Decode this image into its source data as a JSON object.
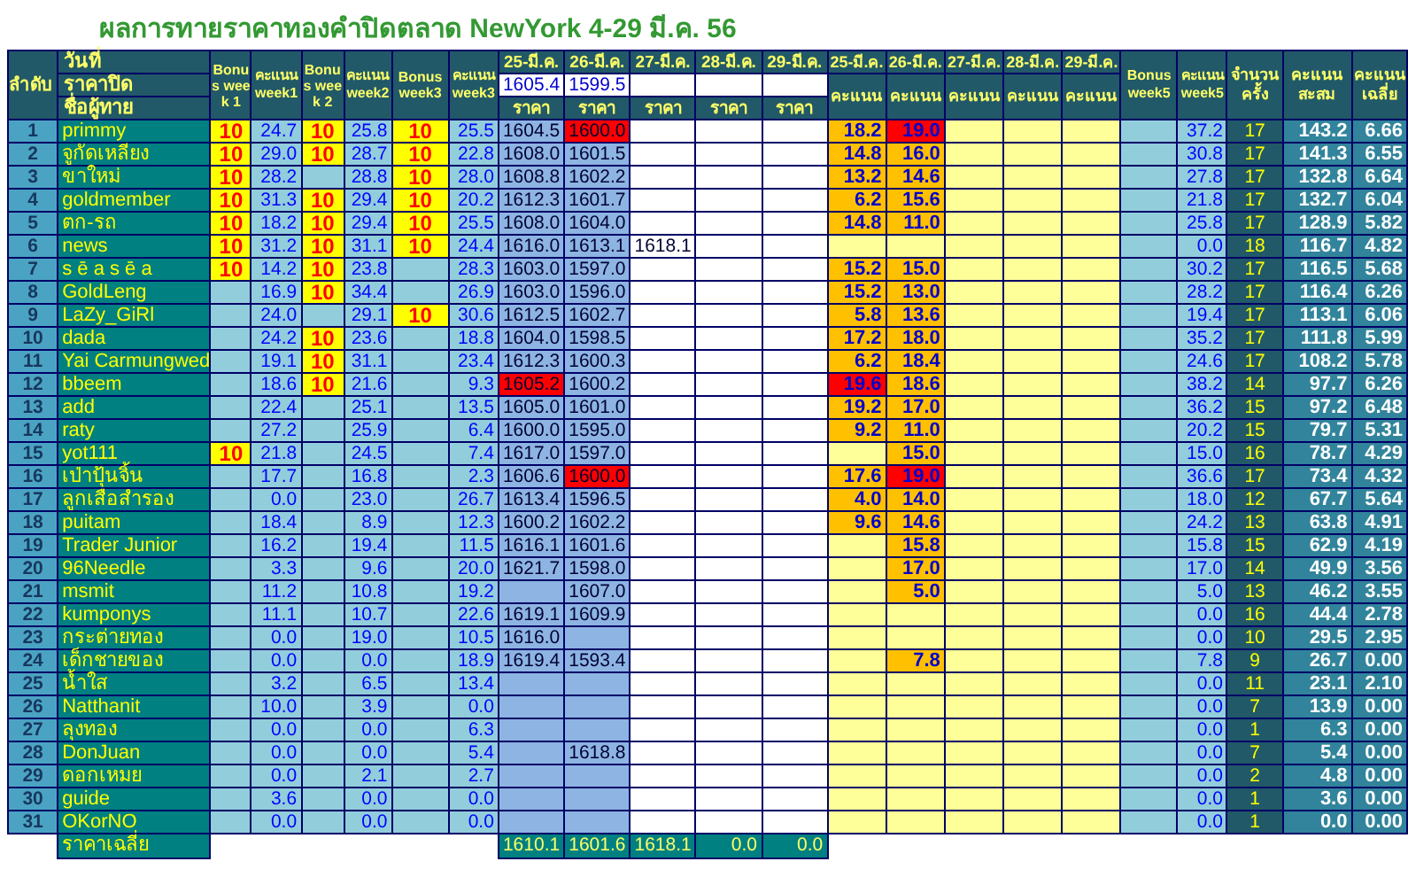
{
  "title": "ผลการทายราคาทองคำปิดตลาด NewYork 4-29 มี.ค. 56",
  "header": {
    "rank": "ลำดับ",
    "date_label": "วันที่",
    "close_label": "ราคาปิด",
    "name_label": "ชื่อผู้ทาย",
    "bonus_headers": [
      "Bonus week 1",
      "Bonus week 2",
      "Bonus week3"
    ],
    "score_headers": [
      "คะแนน week1",
      "คะแนน week2",
      "คะแนน week3"
    ],
    "price_dates": [
      "25-มี.ค.",
      "26-มี.ค.",
      "27-มี.ค.",
      "28-มี.ค.",
      "29-มี.ค."
    ],
    "closing_prices": {
      "mar_25": "1605.4",
      "mar_26": "1599.5"
    },
    "price_labels": [
      "ราคา",
      "ราคา",
      "ราคา",
      "ราคา",
      "ราคา"
    ],
    "score_dates": [
      "25-มี.ค.",
      "26-มี.ค.",
      "27-มี.ค.",
      "28-มี.ค.",
      "29-มี.ค."
    ],
    "score_labels": [
      "คะแนน",
      "คะแนน",
      "คะแนน",
      "คะแนน",
      "คะแนน"
    ],
    "bonus5": "Bonus week5",
    "score5": "คะแนน week5",
    "count": "จำนวนครั้ง",
    "total": "คะแนนสะสม",
    "average": "คะแนนเฉลี่ย"
  },
  "rows": [
    {
      "rank": "1",
      "name": "primmy",
      "bonuses": {
        "week1": "10",
        "week2": "10",
        "week3": "10"
      },
      "weekly_scores": [
        "24.7",
        "25.8",
        "25.5"
      ],
      "prices": {
        "mar_25": {
          "value": "1604.5",
          "highlighted": false
        },
        "mar_26": {
          "value": "1600.0",
          "highlighted": true
        }
      },
      "day_scores": {
        "mar_25": {
          "value": "18.2",
          "highlighted": false
        },
        "mar_26": {
          "value": "19.0",
          "highlighted": true
        }
      },
      "score_week5": "37.2",
      "count": "17",
      "total": "143.2",
      "average": "6.66"
    },
    {
      "rank": "2",
      "name": "จูกัดเหลียง",
      "bonuses": {
        "week1": "10",
        "week2": "10",
        "week3": "10"
      },
      "weekly_scores": [
        "29.0",
        "28.7",
        "22.8"
      ],
      "prices": {
        "mar_25": {
          "value": "1608.0",
          "highlighted": false
        },
        "mar_26": {
          "value": "1601.5",
          "highlighted": false
        }
      },
      "day_scores": {
        "mar_25": {
          "value": "14.8",
          "highlighted": false
        },
        "mar_26": {
          "value": "16.0",
          "highlighted": false
        }
      },
      "score_week5": "30.8",
      "count": "17",
      "total": "141.3",
      "average": "6.55"
    },
    {
      "rank": "3",
      "name": "ขาใหม่",
      "bonuses": {
        "week1": "10",
        "week3": "10"
      },
      "weekly_scores": [
        "28.2",
        "28.8",
        "28.0"
      ],
      "prices": {
        "mar_25": {
          "value": "1608.8",
          "highlighted": false
        },
        "mar_26": {
          "value": "1602.2",
          "highlighted": false
        }
      },
      "day_scores": {
        "mar_25": {
          "value": "13.2",
          "highlighted": false
        },
        "mar_26": {
          "value": "14.6",
          "highlighted": false
        }
      },
      "score_week5": "27.8",
      "count": "17",
      "total": "132.8",
      "average": "6.64"
    },
    {
      "rank": "4",
      "name": "goldmember",
      "bonuses": {
        "week1": "10",
        "week2": "10",
        "week3": "10"
      },
      "weekly_scores": [
        "31.3",
        "29.4",
        "20.2"
      ],
      "prices": {
        "mar_25": {
          "value": "1612.3",
          "highlighted": false
        },
        "mar_26": {
          "value": "1601.7",
          "highlighted": false
        }
      },
      "day_scores": {
        "mar_25": {
          "value": "6.2",
          "highlighted": false
        },
        "mar_26": {
          "value": "15.6",
          "highlighted": false
        }
      },
      "score_week5": "21.8",
      "count": "17",
      "total": "132.7",
      "average": "6.04"
    },
    {
      "rank": "5",
      "name": "ตก-รถ",
      "bonuses": {
        "week1": "10",
        "week2": "10",
        "week3": "10"
      },
      "weekly_scores": [
        "18.2",
        "29.4",
        "25.5"
      ],
      "prices": {
        "mar_25": {
          "value": "1608.0",
          "highlighted": false
        },
        "mar_26": {
          "value": "1604.0",
          "highlighted": false
        }
      },
      "day_scores": {
        "mar_25": {
          "value": "14.8",
          "highlighted": false
        },
        "mar_26": {
          "value": "11.0",
          "highlighted": false
        }
      },
      "score_week5": "25.8",
      "count": "17",
      "total": "128.9",
      "average": "5.82"
    },
    {
      "rank": "6",
      "name": "news",
      "bonuses": {
        "week1": "10",
        "week2": "10",
        "week3": "10"
      },
      "weekly_scores": [
        "31.2",
        "31.1",
        "24.4"
      ],
      "prices": {
        "mar_25": {
          "value": "1616.0",
          "highlighted": false
        },
        "mar_26": {
          "value": "1613.1",
          "highlighted": false
        },
        "mar_27": {
          "value": "1618.1",
          "highlighted": false
        }
      },
      "day_scores": {},
      "score_week5": "0.0",
      "count": "18",
      "total": "116.7",
      "average": "4.82"
    },
    {
      "rank": "7",
      "name": "s ē a s ē a",
      "bonuses": {
        "week1": "10",
        "week2": "10"
      },
      "weekly_scores": [
        "14.2",
        "23.8",
        "28.3"
      ],
      "prices": {
        "mar_25": {
          "value": "1603.0",
          "highlighted": false
        },
        "mar_26": {
          "value": "1597.0",
          "highlighted": false
        }
      },
      "day_scores": {
        "mar_25": {
          "value": "15.2",
          "highlighted": false
        },
        "mar_26": {
          "value": "15.0",
          "highlighted": false
        }
      },
      "score_week5": "30.2",
      "count": "17",
      "total": "116.5",
      "average": "5.68"
    },
    {
      "rank": "8",
      "name": "GoldLeng",
      "bonuses": {
        "week2": "10"
      },
      "weekly_scores": [
        "16.9",
        "34.4",
        "26.9"
      ],
      "prices": {
        "mar_25": {
          "value": "1603.0",
          "highlighted": false
        },
        "mar_26": {
          "value": "1596.0",
          "highlighted": false
        }
      },
      "day_scores": {
        "mar_25": {
          "value": "15.2",
          "highlighted": false
        },
        "mar_26": {
          "value": "13.0",
          "highlighted": false
        }
      },
      "score_week5": "28.2",
      "count": "17",
      "total": "116.4",
      "average": "6.26"
    },
    {
      "rank": "9",
      "name": "LaZy_GiRl",
      "bonuses": {
        "week3": "10"
      },
      "weekly_scores": [
        "24.0",
        "29.1",
        "30.6"
      ],
      "prices": {
        "mar_25": {
          "value": "1612.5",
          "highlighted": false
        },
        "mar_26": {
          "value": "1602.7",
          "highlighted": false
        }
      },
      "day_scores": {
        "mar_25": {
          "value": "5.8",
          "highlighted": false
        },
        "mar_26": {
          "value": "13.6",
          "highlighted": false
        }
      },
      "score_week5": "19.4",
      "count": "17",
      "total": "113.1",
      "average": "6.06"
    },
    {
      "rank": "10",
      "name": "dada",
      "bonuses": {
        "week2": "10"
      },
      "weekly_scores": [
        "24.2",
        "23.6",
        "18.8"
      ],
      "prices": {
        "mar_25": {
          "value": "1604.0",
          "highlighted": false
        },
        "mar_26": {
          "value": "1598.5",
          "highlighted": false
        }
      },
      "day_scores": {
        "mar_25": {
          "value": "17.2",
          "highlighted": false
        },
        "mar_26": {
          "value": "18.0",
          "highlighted": false
        }
      },
      "score_week5": "35.2",
      "count": "17",
      "total": "111.8",
      "average": "5.99"
    },
    {
      "rank": "11",
      "name": "Yai Carmungwed",
      "bonuses": {
        "week2": "10"
      },
      "weekly_scores": [
        "19.1",
        "31.1",
        "23.4"
      ],
      "prices": {
        "mar_25": {
          "value": "1612.3",
          "highlighted": false
        },
        "mar_26": {
          "value": "1600.3",
          "highlighted": false
        }
      },
      "day_scores": {
        "mar_25": {
          "value": "6.2",
          "highlighted": false
        },
        "mar_26": {
          "value": "18.4",
          "highlighted": false
        }
      },
      "score_week5": "24.6",
      "count": "17",
      "total": "108.2",
      "average": "5.78"
    },
    {
      "rank": "12",
      "name": "bbeem",
      "bonuses": {
        "week2": "10"
      },
      "weekly_scores": [
        "18.6",
        "21.6",
        "9.3"
      ],
      "prices": {
        "mar_25": {
          "value": "1605.2",
          "highlighted": true
        },
        "mar_26": {
          "value": "1600.2",
          "highlighted": false
        }
      },
      "day_scores": {
        "mar_25": {
          "value": "19.6",
          "highlighted": true
        },
        "mar_26": {
          "value": "18.6",
          "highlighted": false
        }
      },
      "score_week5": "38.2",
      "count": "14",
      "total": "97.7",
      "average": "6.26"
    },
    {
      "rank": "13",
      "name": "add",
      "bonuses": {},
      "weekly_scores": [
        "22.4",
        "25.1",
        "13.5"
      ],
      "prices": {
        "mar_25": {
          "value": "1605.0",
          "highlighted": false
        },
        "mar_26": {
          "value": "1601.0",
          "highlighted": false
        }
      },
      "day_scores": {
        "mar_25": {
          "value": "19.2",
          "highlighted": false
        },
        "mar_26": {
          "value": "17.0",
          "highlighted": false
        }
      },
      "score_week5": "36.2",
      "count": "15",
      "total": "97.2",
      "average": "6.48"
    },
    {
      "rank": "14",
      "name": "raty",
      "bonuses": {},
      "weekly_scores": [
        "27.2",
        "25.9",
        "6.4"
      ],
      "prices": {
        "mar_25": {
          "value": "1600.0",
          "highlighted": false
        },
        "mar_26": {
          "value": "1595.0",
          "highlighted": false
        }
      },
      "day_scores": {
        "mar_25": {
          "value": "9.2",
          "highlighted": false
        },
        "mar_26": {
          "value": "11.0",
          "highlighted": false
        }
      },
      "score_week5": "20.2",
      "count": "15",
      "total": "79.7",
      "average": "5.31"
    },
    {
      "rank": "15",
      "name": "yot111",
      "bonuses": {
        "week1": "10"
      },
      "weekly_scores": [
        "21.8",
        "24.5",
        "7.4"
      ],
      "prices": {
        "mar_25": {
          "value": "1617.0",
          "highlighted": false
        },
        "mar_26": {
          "value": "1597.0",
          "highlighted": false
        }
      },
      "day_scores": {
        "mar_26": {
          "value": "15.0",
          "highlighted": false
        }
      },
      "score_week5": "15.0",
      "count": "16",
      "total": "78.7",
      "average": "4.29"
    },
    {
      "rank": "16",
      "name": "เป่าปุ้นจิ้น",
      "bonuses": {},
      "weekly_scores": [
        "17.7",
        "16.8",
        "2.3"
      ],
      "prices": {
        "mar_25": {
          "value": "1606.6",
          "highlighted": false
        },
        "mar_26": {
          "value": "1600.0",
          "highlighted": true
        }
      },
      "day_scores": {
        "mar_25": {
          "value": "17.6",
          "highlighted": false
        },
        "mar_26": {
          "value": "19.0",
          "highlighted": true
        }
      },
      "score_week5": "36.6",
      "count": "17",
      "total": "73.4",
      "average": "4.32"
    },
    {
      "rank": "17",
      "name": "ลูกเสือสำรอง",
      "bonuses": {},
      "weekly_scores": [
        "0.0",
        "23.0",
        "26.7"
      ],
      "prices": {
        "mar_25": {
          "value": "1613.4",
          "highlighted": false
        },
        "mar_26": {
          "value": "1596.5",
          "highlighted": false
        }
      },
      "day_scores": {
        "mar_25": {
          "value": "4.0",
          "highlighted": false
        },
        "mar_26": {
          "value": "14.0",
          "highlighted": false
        }
      },
      "score_week5": "18.0",
      "count": "12",
      "total": "67.7",
      "average": "5.64"
    },
    {
      "rank": "18",
      "name": "puitam",
      "bonuses": {},
      "weekly_scores": [
        "18.4",
        "8.9",
        "12.3"
      ],
      "prices": {
        "mar_25": {
          "value": "1600.2",
          "highlighted": false
        },
        "mar_26": {
          "value": "1602.2",
          "highlighted": false
        }
      },
      "day_scores": {
        "mar_25": {
          "value": "9.6",
          "highlighted": false
        },
        "mar_26": {
          "value": "14.6",
          "highlighted": false
        }
      },
      "score_week5": "24.2",
      "count": "13",
      "total": "63.8",
      "average": "4.91"
    },
    {
      "rank": "19",
      "name": "Trader Junior",
      "bonuses": {},
      "weekly_scores": [
        "16.2",
        "19.4",
        "11.5"
      ],
      "prices": {
        "mar_25": {
          "value": "1616.1",
          "highlighted": false
        },
        "mar_26": {
          "value": "1601.6",
          "highlighted": false
        }
      },
      "day_scores": {
        "mar_26": {
          "value": "15.8",
          "highlighted": false
        }
      },
      "score_week5": "15.8",
      "count": "15",
      "total": "62.9",
      "average": "4.19"
    },
    {
      "rank": "20",
      "name": "96Needle",
      "bonuses": {},
      "weekly_scores": [
        "3.3",
        "9.6",
        "20.0"
      ],
      "prices": {
        "mar_25": {
          "value": "1621.7",
          "highlighted": false
        },
        "mar_26": {
          "value": "1598.0",
          "highlighted": false
        }
      },
      "day_scores": {
        "mar_26": {
          "value": "17.0",
          "highlighted": false
        }
      },
      "score_week5": "17.0",
      "count": "14",
      "total": "49.9",
      "average": "3.56"
    },
    {
      "rank": "21",
      "name": "msmit",
      "bonuses": {},
      "weekly_scores": [
        "11.2",
        "10.8",
        "19.2"
      ],
      "prices": {
        "mar_26": {
          "value": "1607.0",
          "highlighted": false
        }
      },
      "day_scores": {
        "mar_26": {
          "value": "5.0",
          "highlighted": false
        }
      },
      "score_week5": "5.0",
      "count": "13",
      "total": "46.2",
      "average": "3.55"
    },
    {
      "rank": "22",
      "name": "kumponys",
      "bonuses": {},
      "weekly_scores": [
        "11.1",
        "10.7",
        "22.6"
      ],
      "prices": {
        "mar_25": {
          "value": "1619.1",
          "highlighted": false
        },
        "mar_26": {
          "value": "1609.9",
          "highlighted": false
        }
      },
      "day_scores": {},
      "score_week5": "0.0",
      "count": "16",
      "total": "44.4",
      "average": "2.78"
    },
    {
      "rank": "23",
      "name": "กระต่ายทอง",
      "bonuses": {},
      "weekly_scores": [
        "0.0",
        "19.0",
        "10.5"
      ],
      "prices": {
        "mar_25": {
          "value": "1616.0",
          "highlighted": false
        }
      },
      "day_scores": {},
      "score_week5": "0.0",
      "count": "10",
      "total": "29.5",
      "average": "2.95"
    },
    {
      "rank": "24",
      "name": "เด็กชายของ",
      "bonuses": {},
      "weekly_scores": [
        "0.0",
        "0.0",
        "18.9"
      ],
      "prices": {
        "mar_25": {
          "value": "1619.4",
          "highlighted": false
        },
        "mar_26": {
          "value": "1593.4",
          "highlighted": false
        }
      },
      "day_scores": {
        "mar_26": {
          "value": "7.8",
          "highlighted": false
        }
      },
      "score_week5": "7.8",
      "count": "9",
      "total": "26.7",
      "average": "0.00"
    },
    {
      "rank": "25",
      "name": "น้ำใส",
      "bonuses": {},
      "weekly_scores": [
        "3.2",
        "6.5",
        "13.4"
      ],
      "prices": {},
      "day_scores": {},
      "score_week5": "0.0",
      "count": "11",
      "total": "23.1",
      "average": "2.10"
    },
    {
      "rank": "26",
      "name": "Natthanit",
      "bonuses": {},
      "weekly_scores": [
        "10.0",
        "3.9",
        "0.0"
      ],
      "prices": {},
      "day_scores": {},
      "score_week5": "0.0",
      "count": "7",
      "total": "13.9",
      "average": "0.00"
    },
    {
      "rank": "27",
      "name": "ลุงทอง",
      "bonuses": {},
      "weekly_scores": [
        "0.0",
        "0.0",
        "6.3"
      ],
      "prices": {},
      "day_scores": {},
      "score_week5": "0.0",
      "count": "1",
      "total": "6.3",
      "average": "0.00"
    },
    {
      "rank": "28",
      "name": "DonJuan",
      "bonuses": {},
      "weekly_scores": [
        "0.0",
        "0.0",
        "5.4"
      ],
      "prices": {
        "mar_26": {
          "value": "1618.8",
          "highlighted": false
        }
      },
      "day_scores": {},
      "score_week5": "0.0",
      "count": "7",
      "total": "5.4",
      "average": "0.00"
    },
    {
      "rank": "29",
      "name": "ดอกเหมย",
      "bonuses": {},
      "weekly_scores": [
        "0.0",
        "2.1",
        "2.7"
      ],
      "prices": {},
      "day_scores": {},
      "score_week5": "0.0",
      "count": "2",
      "total": "4.8",
      "average": "0.00"
    },
    {
      "rank": "30",
      "name": "guide",
      "bonuses": {},
      "weekly_scores": [
        "3.6",
        "0.0",
        "0.0"
      ],
      "prices": {},
      "day_scores": {},
      "score_week5": "0.0",
      "count": "1",
      "total": "3.6",
      "average": "0.00"
    },
    {
      "rank": "31",
      "name": "OKorNO",
      "bonuses": {},
      "weekly_scores": [
        "0.0",
        "0.0",
        "0.0"
      ],
      "prices": {},
      "day_scores": {},
      "score_week5": "0.0",
      "count": "1",
      "total": "0.0",
      "average": "0.00"
    }
  ],
  "footer": {
    "label": "ราคาเฉลี่ย",
    "average_prices": [
      "1610.1",
      "1601.6",
      "1618.1",
      "0.0",
      "0.0"
    ]
  }
}
